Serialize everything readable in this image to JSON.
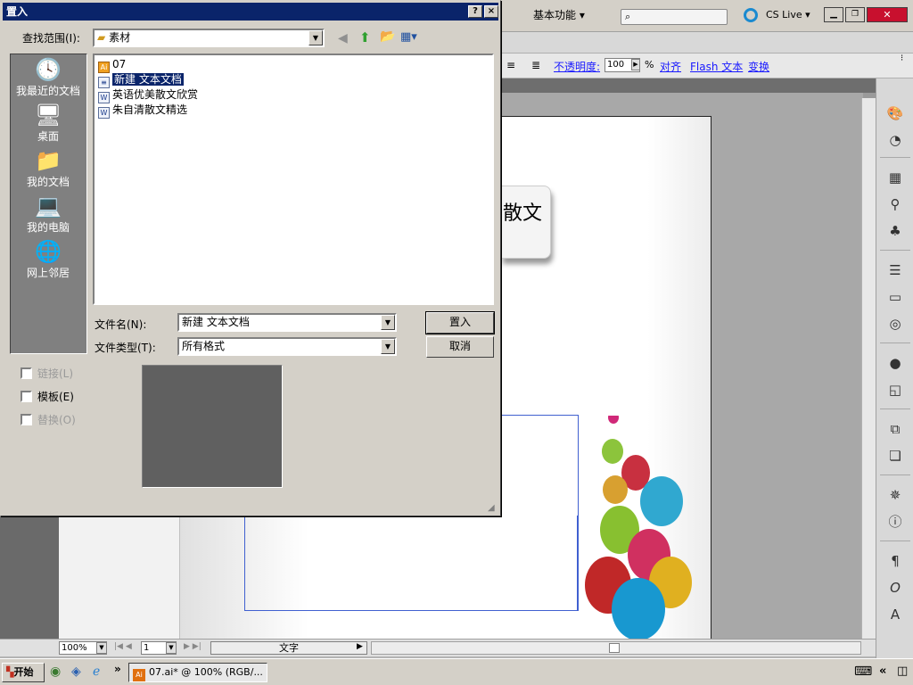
{
  "app": {
    "workspace_label": "基本功能",
    "cslive_label": "CS Live",
    "control_bar": {
      "opacity_label": "不透明度:",
      "opacity_value": "100",
      "opacity_unit": "%",
      "align_label": "对齐",
      "flash_text_label": "Flash 文本",
      "transform_label": "变换"
    },
    "canvas_text": "散文",
    "status": {
      "zoom": "100%",
      "page": "1",
      "mode": "文字"
    }
  },
  "dialog": {
    "title": "置入",
    "help_btn": "?",
    "close_btn": "×",
    "lookin_label": "查找范围(I):",
    "lookin_value": "素材",
    "places": [
      {
        "label": "我最近的文档",
        "icon": "recent-documents-icon"
      },
      {
        "label": "桌面",
        "icon": "desktop-icon"
      },
      {
        "label": "我的文档",
        "icon": "my-documents-icon"
      },
      {
        "label": "我的电脑",
        "icon": "my-computer-icon"
      },
      {
        "label": "网上邻居",
        "icon": "network-places-icon"
      }
    ],
    "files": [
      {
        "name": "07",
        "icon": "ai-file-icon",
        "selected": false
      },
      {
        "name": "新建 文本文档",
        "icon": "text-file-icon",
        "selected": true
      },
      {
        "name": "英语优美散文欣赏",
        "icon": "word-file-icon",
        "selected": false
      },
      {
        "name": "朱自清散文精选",
        "icon": "word-file-icon",
        "selected": false
      }
    ],
    "filename_label": "文件名(N):",
    "filename_value": "新建 文本文档",
    "filetype_label": "文件类型(T):",
    "filetype_value": "所有格式",
    "place_button": "置入",
    "cancel_button": "取消",
    "options": [
      {
        "label": "链接(L)",
        "enabled": false
      },
      {
        "label": "模板(E)",
        "enabled": true
      },
      {
        "label": "替换(O)",
        "enabled": false
      }
    ]
  },
  "taskbar": {
    "start_label": "开始",
    "active_window": "07.ai* @ 100% (RGB/..."
  }
}
